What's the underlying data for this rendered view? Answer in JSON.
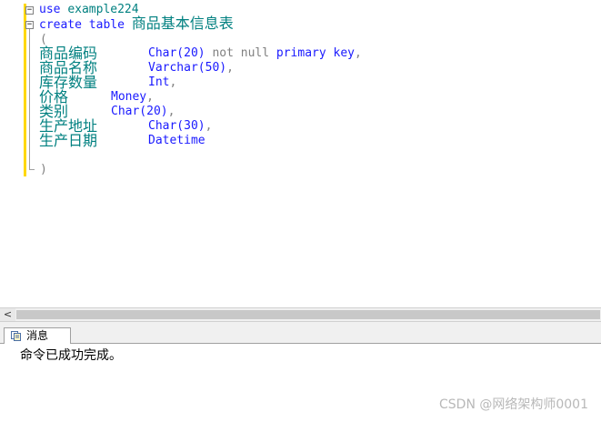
{
  "editor": {
    "line1": {
      "keyword": "use",
      "db": "example224"
    },
    "line2": {
      "keywords": "create table",
      "table_name": "商品基本信息表"
    },
    "open_paren": "(",
    "close_paren": ")",
    "columns": [
      {
        "name": "商品编码",
        "type": "Char(20)",
        "constraint_gray": "not null",
        "constraint_kw": "primary key",
        "suffix": ","
      },
      {
        "name": "商品名称",
        "type": "Varchar(50)",
        "suffix": ","
      },
      {
        "name": "库存数量",
        "type": "Int",
        "suffix": ","
      },
      {
        "name": "价格",
        "type": "Money",
        "suffix": ","
      },
      {
        "name": "类别",
        "type": "Char(20)",
        "suffix": ","
      },
      {
        "name": "生产地址",
        "type": "Char(30)",
        "suffix": ","
      },
      {
        "name": "生产日期",
        "type": "Datetime",
        "suffix": ""
      }
    ]
  },
  "scrollbar": {
    "left_arrow": "<"
  },
  "results": {
    "tab_label": "消息",
    "message": "命令已成功完成。"
  },
  "watermark": "CSDN @网络架构师0001",
  "colors": {
    "keyword": "#1a1aff",
    "identifier": "#008080",
    "gray": "#808080",
    "change_bar": "#ffd800"
  },
  "icons": [
    "collapse-icon",
    "messages-tab-icon"
  ]
}
